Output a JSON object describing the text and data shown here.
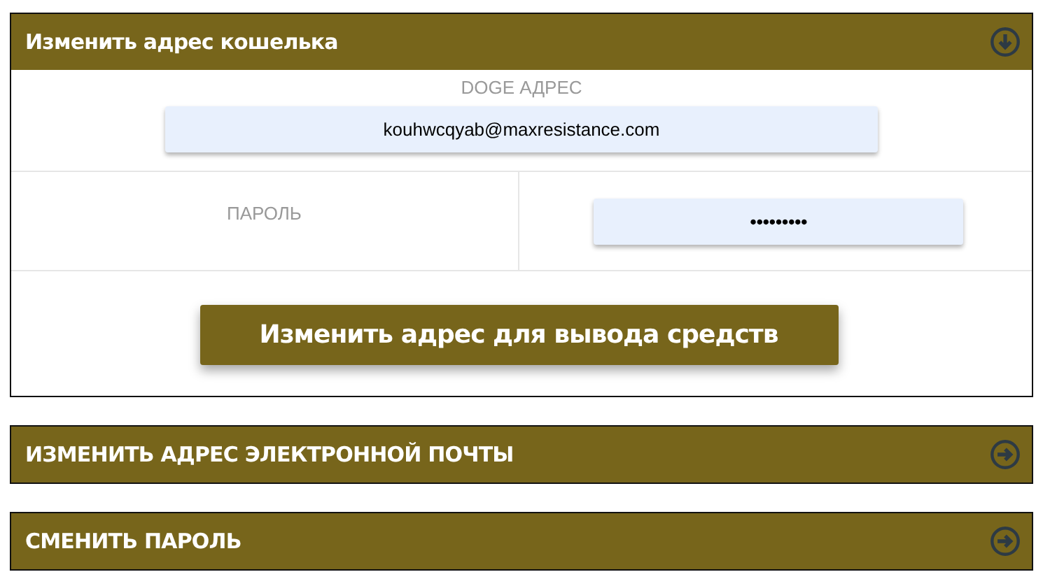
{
  "sections": [
    {
      "title": "Изменить адрес кошелька",
      "expanded": true,
      "fields": [
        {
          "kind": "stacked",
          "label": "DOGE АДРЕС",
          "value": "kouhwcqyab@maxresistance.com"
        },
        {
          "kind": "split",
          "label": "ПАРОЛЬ",
          "value": "•••••••••"
        }
      ],
      "button": "Изменить адрес для вывода средств"
    },
    {
      "title": "ИЗМЕНИТЬ АДРЕС ЭЛЕКТРОННОЙ ПОЧТЫ",
      "expanded": false
    },
    {
      "title": "СМЕНИТЬ ПАРОЛЬ",
      "expanded": false
    }
  ]
}
